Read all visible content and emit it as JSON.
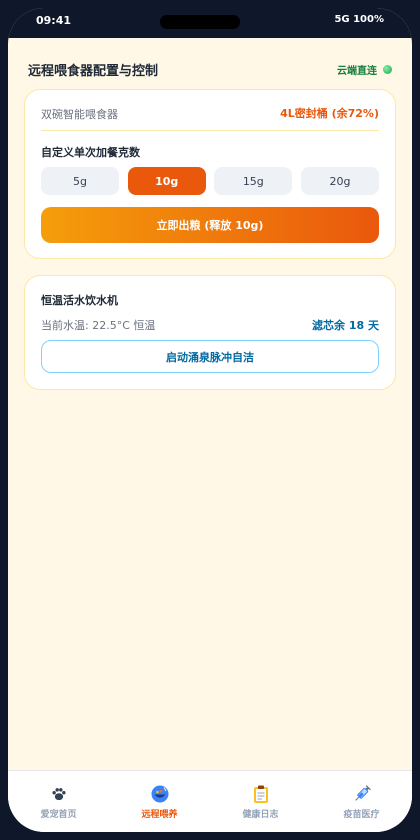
{
  "status_bar": {
    "time": "09:41",
    "signal": "5G  100%"
  },
  "header": {
    "title": "远程喂食器配置与控制",
    "cloud_status": "云端直连"
  },
  "feeder": {
    "name": "双碗智能喂食器",
    "bucket": "4L密封桶 (余72%)",
    "portion_label": "自定义单次加餐克数",
    "portions": [
      "5g",
      "10g",
      "15g",
      "20g"
    ],
    "selected_portion": "10g",
    "dispense_label": "立即出粮 (释放 10g)"
  },
  "water": {
    "title": "恒温活水饮水机",
    "temperature": "当前水温: 22.5°C 恒温",
    "filter": "滤芯余 18 天",
    "clean_label": "启动涌泉脉冲自洁"
  },
  "tabs": [
    {
      "label": "爱宠首页",
      "icon": "paw-icon"
    },
    {
      "label": "远程喂养",
      "icon": "bowl-icon"
    },
    {
      "label": "健康日志",
      "icon": "clipboard-icon"
    },
    {
      "label": "疫苗医疗",
      "icon": "syringe-icon"
    }
  ],
  "active_tab": "远程喂养",
  "colors": {
    "accent": "#ea580c",
    "water_accent": "#0369a1",
    "cloud": "#15803d",
    "background": "#fff8e6"
  }
}
